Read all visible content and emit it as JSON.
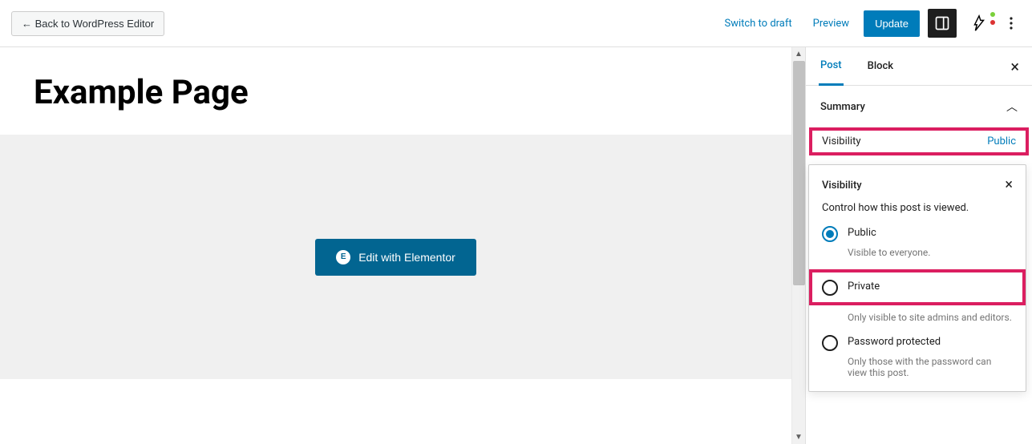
{
  "topbar": {
    "back_label": "← Back to WordPress Editor",
    "switch_draft": "Switch to draft",
    "preview": "Preview",
    "update": "Update"
  },
  "page": {
    "title": "Example Page"
  },
  "elementor": {
    "button_label": "Edit with Elementor",
    "icon_letter": "E"
  },
  "sidebar": {
    "tabs": {
      "post": "Post",
      "block": "Block"
    },
    "summary_label": "Summary",
    "visibility_label": "Visibility",
    "visibility_value": "Public"
  },
  "popup": {
    "title": "Visibility",
    "description": "Control how this post is viewed.",
    "options": {
      "public": {
        "label": "Public",
        "help": "Visible to everyone."
      },
      "private": {
        "label": "Private",
        "help": "Only visible to site admins and editors."
      },
      "password": {
        "label": "Password protected",
        "help": "Only those with the password can view this post."
      }
    }
  }
}
